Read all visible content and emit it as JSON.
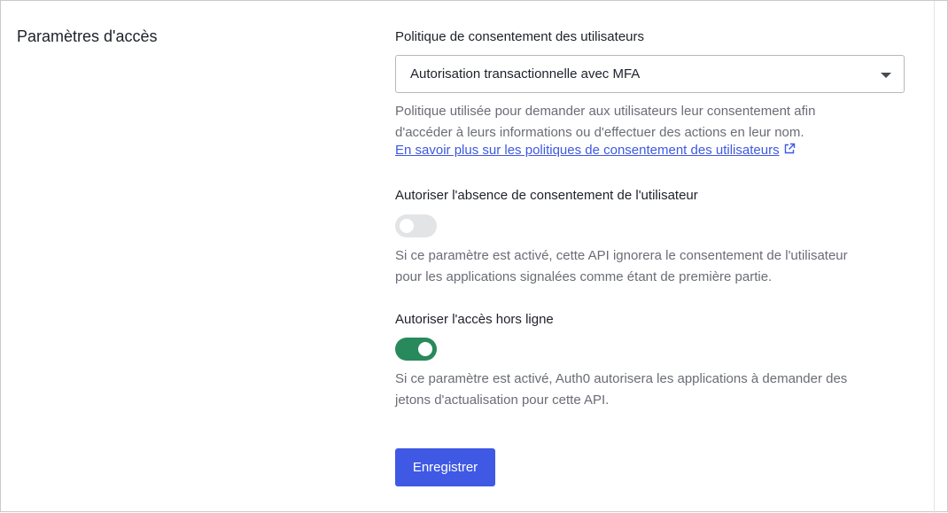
{
  "section": {
    "title": "Paramètres d'accès"
  },
  "consent_policy": {
    "label": "Politique de consentement des utilisateurs",
    "selected": "Autorisation transactionnelle avec MFA",
    "help_lines": [
      "Politique utilisée pour demander aux utilisateurs leur consentement afin",
      "d'accéder à leurs informations ou d'effectuer des actions en leur nom."
    ],
    "link_text": "En savoir plus sur les politiques de consentement des utilisateurs",
    "link_icon": "external-link-icon"
  },
  "skip_consent": {
    "label": "Autoriser l'absence de consentement de l'utilisateur",
    "enabled": false,
    "help_lines": [
      "Si ce paramètre est activé, cette API ignorera le consentement de l'utilisateur",
      "pour les applications signalées comme étant de première partie."
    ]
  },
  "offline_access": {
    "label": "Autoriser l'accès hors ligne",
    "enabled": true,
    "help_lines": [
      "Si ce paramètre est activé, Auth0 autorisera les applications à demander des",
      "jetons d'actualisation pour cette API."
    ]
  },
  "save_button": {
    "label": "Enregistrer"
  },
  "colors": {
    "accent": "#3f59e4",
    "link": "#3e58e1",
    "toggle_on": "#28895c",
    "toggle_off": "#e3e4e6",
    "help_text": "#6a6d75"
  }
}
